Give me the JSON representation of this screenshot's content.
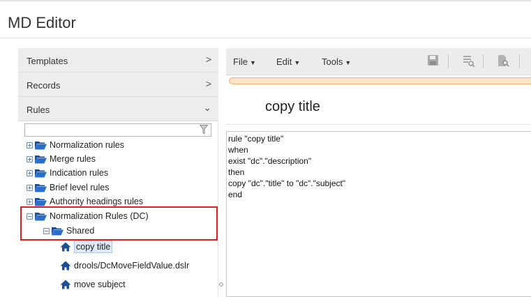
{
  "header": {
    "title": "MD Editor"
  },
  "sidebar": {
    "accordion": [
      {
        "label": "Templates",
        "chevron": ">",
        "expanded": false
      },
      {
        "label": "Records",
        "chevron": ">",
        "expanded": false
      },
      {
        "label": "Rules",
        "chevron": "⌄",
        "expanded": true
      }
    ],
    "search": {
      "value": "",
      "placeholder": "",
      "icon": "filter-icon"
    },
    "tree": [
      {
        "label": "Normalization rules",
        "expander": "+",
        "icon": "folder-open-icon"
      },
      {
        "label": "Merge rules",
        "expander": "+",
        "icon": "folder-open-icon"
      },
      {
        "label": "Indication rules",
        "expander": "+",
        "icon": "folder-open-icon"
      },
      {
        "label": "Brief level rules",
        "expander": "+",
        "icon": "folder-open-icon"
      },
      {
        "label": "Authority headings rules",
        "expander": "+",
        "icon": "folder-open-icon"
      },
      {
        "label": "Normalization Rules (DC)",
        "expander": "−",
        "icon": "folder-open-icon"
      },
      {
        "label": "Shared",
        "expander": "−",
        "icon": "folder-open-icon"
      }
    ],
    "leaves": [
      {
        "label": "copy title",
        "icon": "home-icon",
        "selected": true
      },
      {
        "label": "drools/DcMoveFieldValue.dslr",
        "icon": "home-icon",
        "selected": false
      },
      {
        "label": "move subject",
        "icon": "home-icon",
        "selected": false
      }
    ]
  },
  "toolbar": {
    "menus": [
      {
        "label": "File",
        "caret": "▼"
      },
      {
        "label": "Edit",
        "caret": "▼"
      },
      {
        "label": "Tools",
        "caret": "▼"
      }
    ],
    "buttons": [
      "save-icon",
      "validate-icon",
      "preview-icon"
    ]
  },
  "progress": {
    "level": 1.0,
    "color": "#fbe3c8"
  },
  "document": {
    "title": "copy title",
    "code": [
      "rule \"copy title\"",
      "when",
      "exist \"dc\".\"description\"",
      "then",
      "copy \"dc\".\"title\" to \"dc\".\"subject\"",
      "end"
    ]
  },
  "colors": {
    "highlight": "#e02020",
    "accent": "#1f4e8c",
    "toolbar_bg": "#ececec"
  }
}
